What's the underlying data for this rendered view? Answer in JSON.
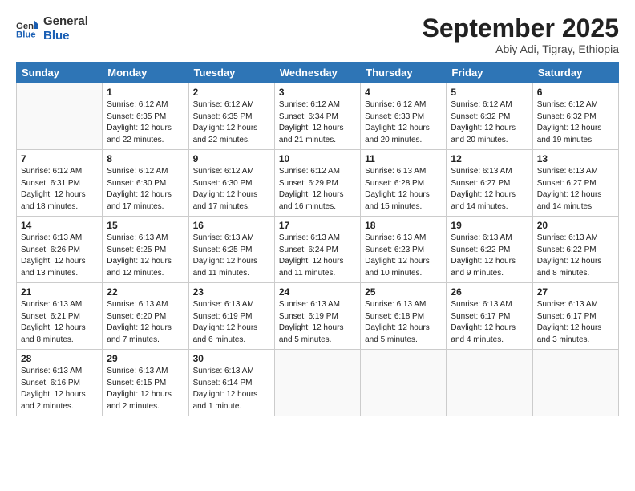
{
  "logo": {
    "line1": "General",
    "line2": "Blue"
  },
  "title": "September 2025",
  "subtitle": "Abiy Adi, Tigray, Ethiopia",
  "headers": [
    "Sunday",
    "Monday",
    "Tuesday",
    "Wednesday",
    "Thursday",
    "Friday",
    "Saturday"
  ],
  "weeks": [
    [
      {
        "day": "",
        "info": ""
      },
      {
        "day": "1",
        "info": "Sunrise: 6:12 AM\nSunset: 6:35 PM\nDaylight: 12 hours\nand 22 minutes."
      },
      {
        "day": "2",
        "info": "Sunrise: 6:12 AM\nSunset: 6:35 PM\nDaylight: 12 hours\nand 22 minutes."
      },
      {
        "day": "3",
        "info": "Sunrise: 6:12 AM\nSunset: 6:34 PM\nDaylight: 12 hours\nand 21 minutes."
      },
      {
        "day": "4",
        "info": "Sunrise: 6:12 AM\nSunset: 6:33 PM\nDaylight: 12 hours\nand 20 minutes."
      },
      {
        "day": "5",
        "info": "Sunrise: 6:12 AM\nSunset: 6:32 PM\nDaylight: 12 hours\nand 20 minutes."
      },
      {
        "day": "6",
        "info": "Sunrise: 6:12 AM\nSunset: 6:32 PM\nDaylight: 12 hours\nand 19 minutes."
      }
    ],
    [
      {
        "day": "7",
        "info": "Sunrise: 6:12 AM\nSunset: 6:31 PM\nDaylight: 12 hours\nand 18 minutes."
      },
      {
        "day": "8",
        "info": "Sunrise: 6:12 AM\nSunset: 6:30 PM\nDaylight: 12 hours\nand 17 minutes."
      },
      {
        "day": "9",
        "info": "Sunrise: 6:12 AM\nSunset: 6:30 PM\nDaylight: 12 hours\nand 17 minutes."
      },
      {
        "day": "10",
        "info": "Sunrise: 6:12 AM\nSunset: 6:29 PM\nDaylight: 12 hours\nand 16 minutes."
      },
      {
        "day": "11",
        "info": "Sunrise: 6:13 AM\nSunset: 6:28 PM\nDaylight: 12 hours\nand 15 minutes."
      },
      {
        "day": "12",
        "info": "Sunrise: 6:13 AM\nSunset: 6:27 PM\nDaylight: 12 hours\nand 14 minutes."
      },
      {
        "day": "13",
        "info": "Sunrise: 6:13 AM\nSunset: 6:27 PM\nDaylight: 12 hours\nand 14 minutes."
      }
    ],
    [
      {
        "day": "14",
        "info": "Sunrise: 6:13 AM\nSunset: 6:26 PM\nDaylight: 12 hours\nand 13 minutes."
      },
      {
        "day": "15",
        "info": "Sunrise: 6:13 AM\nSunset: 6:25 PM\nDaylight: 12 hours\nand 12 minutes."
      },
      {
        "day": "16",
        "info": "Sunrise: 6:13 AM\nSunset: 6:25 PM\nDaylight: 12 hours\nand 11 minutes."
      },
      {
        "day": "17",
        "info": "Sunrise: 6:13 AM\nSunset: 6:24 PM\nDaylight: 12 hours\nand 11 minutes."
      },
      {
        "day": "18",
        "info": "Sunrise: 6:13 AM\nSunset: 6:23 PM\nDaylight: 12 hours\nand 10 minutes."
      },
      {
        "day": "19",
        "info": "Sunrise: 6:13 AM\nSunset: 6:22 PM\nDaylight: 12 hours\nand 9 minutes."
      },
      {
        "day": "20",
        "info": "Sunrise: 6:13 AM\nSunset: 6:22 PM\nDaylight: 12 hours\nand 8 minutes."
      }
    ],
    [
      {
        "day": "21",
        "info": "Sunrise: 6:13 AM\nSunset: 6:21 PM\nDaylight: 12 hours\nand 8 minutes."
      },
      {
        "day": "22",
        "info": "Sunrise: 6:13 AM\nSunset: 6:20 PM\nDaylight: 12 hours\nand 7 minutes."
      },
      {
        "day": "23",
        "info": "Sunrise: 6:13 AM\nSunset: 6:19 PM\nDaylight: 12 hours\nand 6 minutes."
      },
      {
        "day": "24",
        "info": "Sunrise: 6:13 AM\nSunset: 6:19 PM\nDaylight: 12 hours\nand 5 minutes."
      },
      {
        "day": "25",
        "info": "Sunrise: 6:13 AM\nSunset: 6:18 PM\nDaylight: 12 hours\nand 5 minutes."
      },
      {
        "day": "26",
        "info": "Sunrise: 6:13 AM\nSunset: 6:17 PM\nDaylight: 12 hours\nand 4 minutes."
      },
      {
        "day": "27",
        "info": "Sunrise: 6:13 AM\nSunset: 6:17 PM\nDaylight: 12 hours\nand 3 minutes."
      }
    ],
    [
      {
        "day": "28",
        "info": "Sunrise: 6:13 AM\nSunset: 6:16 PM\nDaylight: 12 hours\nand 2 minutes."
      },
      {
        "day": "29",
        "info": "Sunrise: 6:13 AM\nSunset: 6:15 PM\nDaylight: 12 hours\nand 2 minutes."
      },
      {
        "day": "30",
        "info": "Sunrise: 6:13 AM\nSunset: 6:14 PM\nDaylight: 12 hours\nand 1 minute."
      },
      {
        "day": "",
        "info": ""
      },
      {
        "day": "",
        "info": ""
      },
      {
        "day": "",
        "info": ""
      },
      {
        "day": "",
        "info": ""
      }
    ]
  ]
}
